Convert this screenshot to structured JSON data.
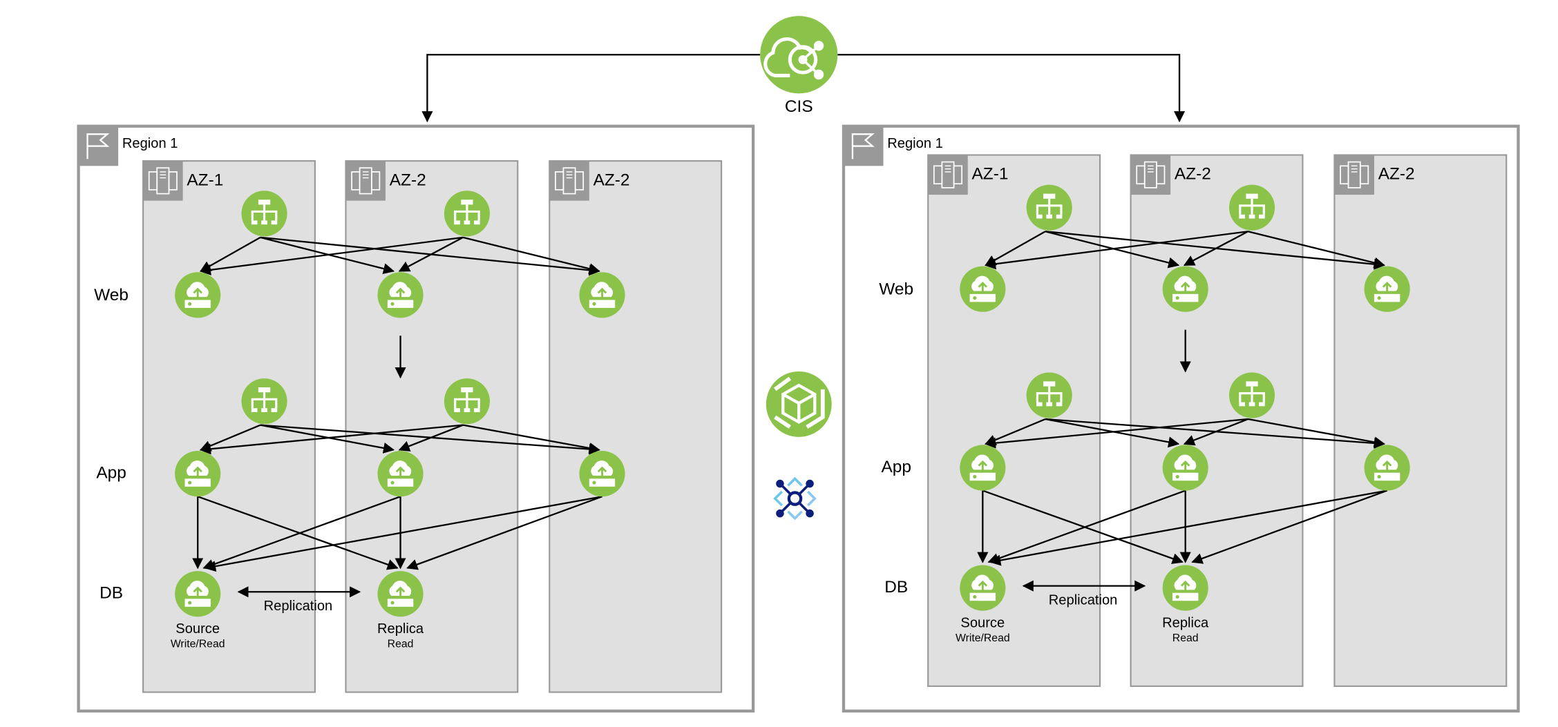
{
  "colors": {
    "green": "#8BC34A",
    "az_fill": "#E0E0E0",
    "border": "#999999",
    "edge": "#000000",
    "net_dark": "#0D1F7C",
    "net_light": "#5BC8E8"
  },
  "cis": {
    "label": "CIS",
    "icon": "cloud-share-icon"
  },
  "center_icons": [
    "cube-service-icon",
    "network-hub-icon"
  ],
  "regions": [
    {
      "title": "Region 1",
      "azs": [
        "AZ-1",
        "AZ-2",
        "AZ-2"
      ],
      "tiers": [
        "Web",
        "App",
        "DB"
      ],
      "db": {
        "source_label": "Source",
        "source_sub": "Write/Read",
        "replica_label": "Replica",
        "replica_sub": "Read",
        "replication_label": "Replication"
      }
    },
    {
      "title": "Region 1",
      "azs": [
        "AZ-1",
        "AZ-2",
        "AZ-2"
      ],
      "tiers": [
        "Web",
        "App",
        "DB"
      ],
      "db": {
        "source_label": "Source",
        "source_sub": "Write/Read",
        "replica_label": "Replica",
        "replica_sub": "Read",
        "replication_label": "Replication"
      }
    }
  ]
}
